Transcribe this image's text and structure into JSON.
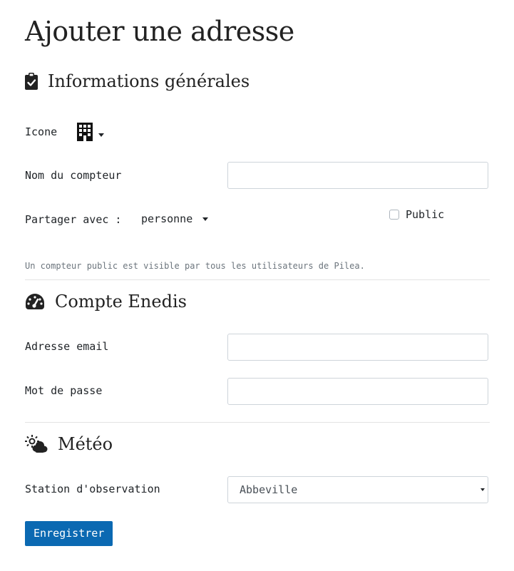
{
  "page": {
    "title": "Ajouter une adresse"
  },
  "general": {
    "heading": "Informations générales",
    "heading_icon": "clipboard-check-icon",
    "icon_label": "Icone",
    "icon_value": "building-icon",
    "name_label": "Nom du compteur",
    "name_value": "",
    "share_label": "Partager avec :",
    "share_value": "personne",
    "public_label": "Public",
    "public_checked": false,
    "help_text": "Un compteur public est visible par tous les utilisateurs de Pilea."
  },
  "enedis": {
    "heading": "Compte Enedis",
    "heading_icon": "tachometer-icon",
    "email_label": "Adresse email",
    "email_value": "",
    "password_label": "Mot de passe",
    "password_value": ""
  },
  "meteo": {
    "heading": "Météo",
    "heading_icon": "cloud-sun-icon",
    "station_label": "Station d'observation",
    "station_value": "Abbeville"
  },
  "actions": {
    "submit_label": "Enregistrer"
  },
  "colors": {
    "primary_button": "#0b69b2",
    "text": "#212529",
    "muted": "#6c757d",
    "border": "#ced4da"
  }
}
